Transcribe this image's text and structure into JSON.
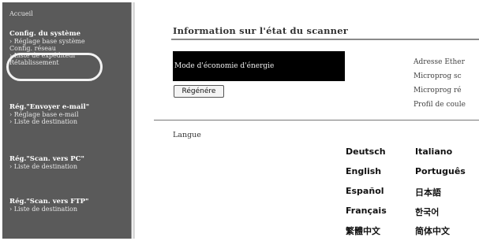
{
  "sidebar": {
    "home": "Accueil",
    "sections": [
      {
        "title": "Config. du système",
        "links": [
          "› Réglage base système",
          "Config. réseau",
          "› Liste de expéditeur",
          "Rétablissement"
        ]
      },
      {
        "title": "Rég.\"Envoyer e-mail\"",
        "links": [
          "› Réglage base e-mail",
          "› Liste de destination"
        ]
      },
      {
        "title": "Rég.\"Scan. vers PC\"",
        "links": [
          "› Liste de destination"
        ]
      },
      {
        "title": "Rég.\"Scan. vers FTP\"",
        "links": [
          "› Liste de destination"
        ]
      }
    ]
  },
  "main": {
    "title": "Information sur l'état du scanner",
    "status_text": "Mode d'économie d'énergie",
    "regen_button": "Régénére",
    "info_labels": [
      "Adresse Ether",
      "Microprog sc",
      "Microprog ré",
      "Profil de coule"
    ],
    "language_label": "Langue",
    "languages": [
      [
        "Deutsch",
        "Italiano"
      ],
      [
        "English",
        "Português"
      ],
      [
        "Español",
        "日本語"
      ],
      [
        "Français",
        "한국어"
      ],
      [
        "繁體中文",
        "简体中文"
      ]
    ]
  }
}
